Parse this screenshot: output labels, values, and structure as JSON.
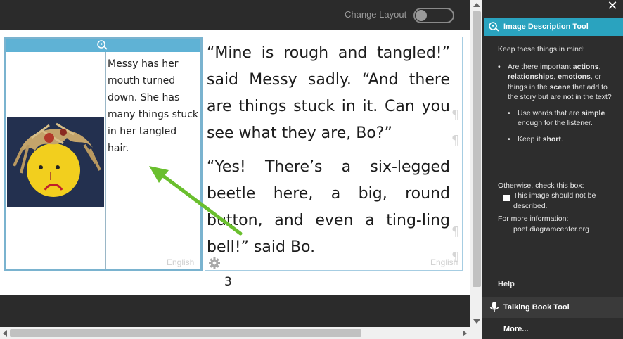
{
  "topbar": {
    "change_layout_label": "Change Layout"
  },
  "image_description": {
    "text_lines": [
      "Messy has her",
      "mouth turned",
      "down. She has",
      "many things stuck",
      "in her tangled",
      "hair."
    ],
    "language": "English"
  },
  "story": {
    "paragraphs": [
      "“Mine is rough and tangled!” said Messy sadly. “And there are things stuck in it. Can you see what they are, Bo?”",
      "“Yes! There’s a six-legged beetle here, a big, round button, and even a ting-ling bell!” said Bo."
    ],
    "language": "English"
  },
  "page_number": "3",
  "panel": {
    "tool_title": "Image Description Tool",
    "keep_in_mind": "Keep these things in mind:",
    "bullet1_prefix": "Are there important ",
    "bullet1_actions": "actions",
    "bullet1_sep1": ", ",
    "bullet1_relationships": "relationships",
    "bullet1_sep2": ", ",
    "bullet1_emotions": "emotions",
    "bullet1_mid": ", or things in the ",
    "bullet1_scene": "scene",
    "bullet1_suffix": " that add to the story but are not in the text?",
    "bullet2_prefix": "Use words that are ",
    "bullet2_simple": "simple",
    "bullet2_suffix": " enough for the listener.",
    "bullet3_prefix": "Keep it ",
    "bullet3_short": "short",
    "bullet3_suffix": ".",
    "otherwise": "Otherwise, check this box:",
    "checkbox_label": "This image should not be described.",
    "more_info_label": "For more information:",
    "more_info_link": "poet.diagramcenter.org",
    "help": "Help",
    "talking_book": "Talking Book Tool",
    "more": "More..."
  },
  "colors": {
    "accent": "#2aa3bf",
    "image_header": "#5fb2d5",
    "arrow": "#6abf2e"
  }
}
